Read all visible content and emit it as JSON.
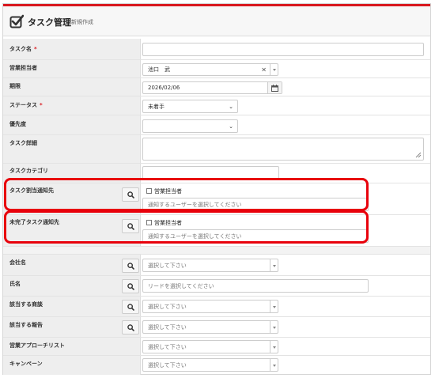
{
  "header": {
    "title": "タスク管理",
    "subtitle": "新規作成"
  },
  "colors": {
    "accent": "#d9181e",
    "highlight": "#e8000b"
  },
  "fields": {
    "task_name": {
      "label": "タスク名",
      "required": "*",
      "value": ""
    },
    "sales_rep": {
      "label": "営業担当者",
      "value": "池口　武",
      "clear": "×"
    },
    "deadline": {
      "label": "期限",
      "value": "2026/02/06"
    },
    "status": {
      "label": "ステータス",
      "required": "*",
      "value": "未着手"
    },
    "priority": {
      "label": "優先度",
      "value": ""
    },
    "task_detail": {
      "label": "タスク詳細",
      "value": ""
    },
    "task_category": {
      "label": "タスクカテゴリ",
      "value": ""
    },
    "task_assign_notify": {
      "label": "タスク割当通知先",
      "checkbox_label": "営業担当者",
      "placeholder": "通知するユーザーを選択してください"
    },
    "incomplete_notify": {
      "label": "未完了タスク通知先",
      "checkbox_label": "営業担当者",
      "placeholder": "通知するユーザーを選択してください"
    },
    "company": {
      "label": "会社名",
      "placeholder": "選択して下さい"
    },
    "name": {
      "label": "氏名",
      "placeholder": "リードを選択してください"
    },
    "deal": {
      "label": "該当する商談",
      "placeholder": "選択して下さい"
    },
    "report": {
      "label": "該当する報告",
      "placeholder": "選択して下さい"
    },
    "approach_list": {
      "label": "営業アプローチリスト",
      "placeholder": "選択して下さい"
    },
    "campaign": {
      "label": "キャンペーン",
      "placeholder": "選択して下さい"
    }
  }
}
